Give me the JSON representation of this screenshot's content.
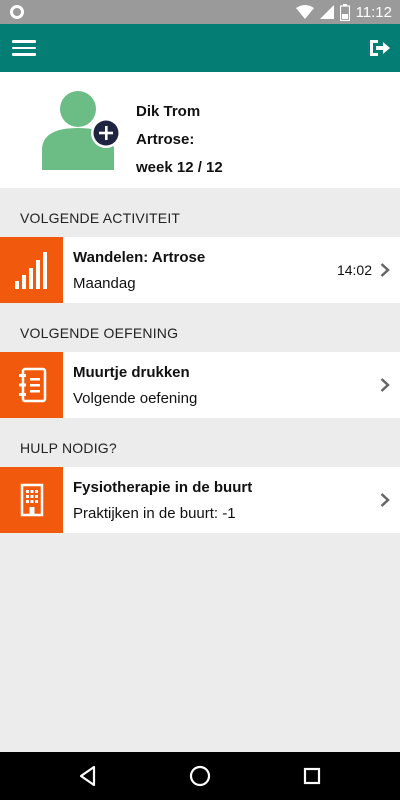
{
  "status_bar": {
    "time": "11:12"
  },
  "profile": {
    "name": "Dik Trom",
    "condition": "Artrose:",
    "week": "week 12 / 12"
  },
  "sections": {
    "activity": "VOLGENDE ACTIVITEIT",
    "exercise": "VOLGENDE OEFENING",
    "help": "HULP NODIG?"
  },
  "cards": {
    "activity": {
      "title": "Wandelen: Artrose",
      "subtitle": "Maandag",
      "time": "14:02"
    },
    "exercise": {
      "title": "Muurtje drukken",
      "subtitle": "Volgende oefening"
    },
    "help": {
      "title": "Fysiotherapie in de buurt",
      "subtitle": "Praktijken in de buurt: -1"
    }
  },
  "colors": {
    "primary": "#047e74",
    "accent": "#f15a0d",
    "avatar": "#6cbd85"
  },
  "icons": [
    "menu-icon",
    "logout-icon",
    "avatar-add-icon",
    "signal-bars-icon",
    "notebook-icon",
    "building-icon",
    "chevron-right-icon"
  ]
}
